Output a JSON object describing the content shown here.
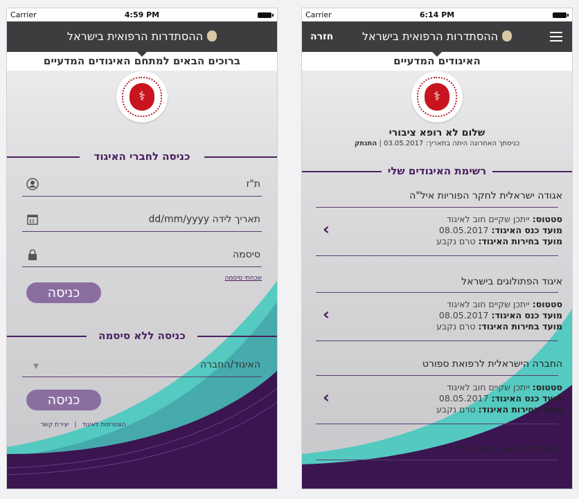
{
  "left": {
    "status": {
      "carrier": "Carrier",
      "time": "4:59 PM"
    },
    "nav_title": "ההסתדרות הרפואית בישראל",
    "subheader": "ברוכים הבאים למתחם האיגודים המדעיים",
    "login_title": "כניסה לחברי האיגוד",
    "field_id": "ת\"ז",
    "field_dob": "תאריך לידה dd/mm/yyyy",
    "field_password": "סיסמה",
    "forgot": "שכחתי סיסמה",
    "login_button": "כניסה",
    "nopass_title": "כניסה ללא סיסמה",
    "select_value": "האיגוד/החברה",
    "login_button2": "כניסה",
    "link_join": "הצטרפות לאיגוד",
    "link_sep": "|",
    "link_contact": "יצירת קשר"
  },
  "right": {
    "status": {
      "carrier": "Carrier",
      "time": "6:14 PM"
    },
    "back": "חזרה",
    "nav_title": "ההסתדרות הרפואית בישראל",
    "subheader": "האיגודים המדעיים",
    "greeting": "שלום  לא רופא ציבורי",
    "last_login": "כניסתך האחרונה היתה בתאריך: 03.05.2017",
    "logout_sep": "|",
    "logout": "התנתק",
    "list_title": "רשימת האיגודים שלי",
    "items": [
      {
        "name": "אגודה ישראלית לחקר הפוריות איל\"ה",
        "status_label": "סטטוס:",
        "status_value": "ייתכן שקיים חוב לאיגוד",
        "meeting_label": "מועד כנס האיגוד:",
        "meeting_value": "08.05.2017",
        "elections_label": "מועד בחירות האיגוד:",
        "elections_value": "טרם נקבע"
      },
      {
        "name": "איגוד הפתולוגים בישראל",
        "status_label": "סטטוס:",
        "status_value": "ייתכן שקיים חוב לאיגוד",
        "meeting_label": "מועד כנס האיגוד:",
        "meeting_value": "08.05.2017",
        "elections_label": "מועד בחירות האיגוד:",
        "elections_value": "טרם נקבע"
      },
      {
        "name": "החברה הישראלית לרפואת ספורט",
        "status_label": "סטטוס:",
        "status_value": "ייתכן שקיים חוב לאיגוד",
        "meeting_label": "מועד כנס האיגוד:",
        "meeting_value": "08.05.2017",
        "elections_label": "מועד בחירות האיגוד:",
        "elections_value": "טרם נקבע"
      },
      {
        "name": "האיגוד לרפואה גריאטרית"
      }
    ]
  },
  "colors": {
    "accent": "#4a1f5e",
    "navbar": "#3d3d40",
    "button": "#8b6ea0",
    "teal": "#3fc9bd",
    "emblem_red": "#c8141f"
  }
}
